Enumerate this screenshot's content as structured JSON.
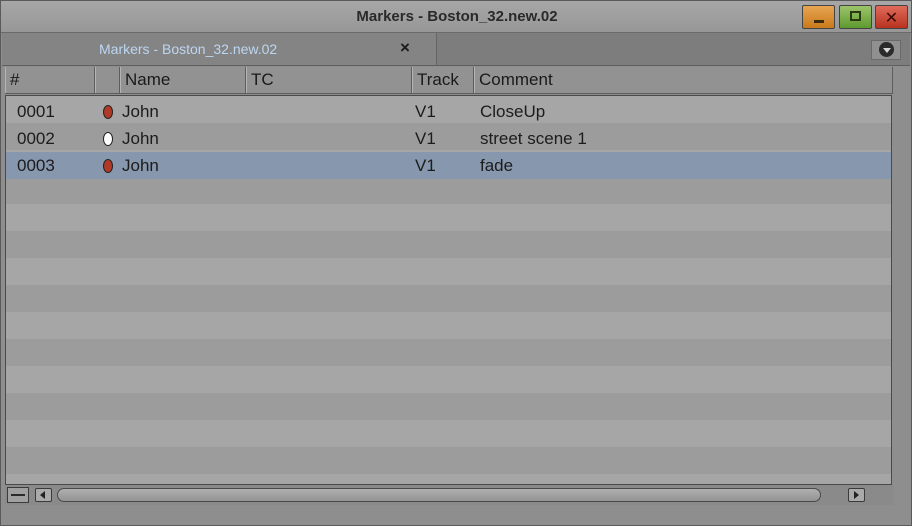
{
  "window": {
    "title": "Markers - Boston_32.new.02",
    "controls": [
      "minimize-icon",
      "maximize-icon",
      "close-icon"
    ],
    "close_glyph": "✕"
  },
  "tab": {
    "label": "Markers - Boston_32.new.02",
    "close_glyph": "×",
    "menu_icon": "dropdown-circle-icon"
  },
  "columns": [
    "#",
    "",
    "Name",
    "TC",
    "Track",
    "Comment"
  ],
  "rows": [
    {
      "number": "0001",
      "color": "#b03a28",
      "name": "John",
      "tc": "",
      "track": "V1",
      "comment": "CloseUp",
      "selected": false
    },
    {
      "number": "0002",
      "color": "#ffffff",
      "name": "John",
      "tc": "",
      "track": "V1",
      "comment": "street scene 1",
      "selected": false
    },
    {
      "number": "0003",
      "color": "#b03a28",
      "name": "John",
      "tc": "",
      "track": "V1",
      "comment": "fade",
      "selected": true
    }
  ],
  "colors": {
    "selection": "#8797ad",
    "tab_label": "#bcd6f2",
    "marker_red": "#b03a28",
    "marker_white": "#ffffff"
  }
}
